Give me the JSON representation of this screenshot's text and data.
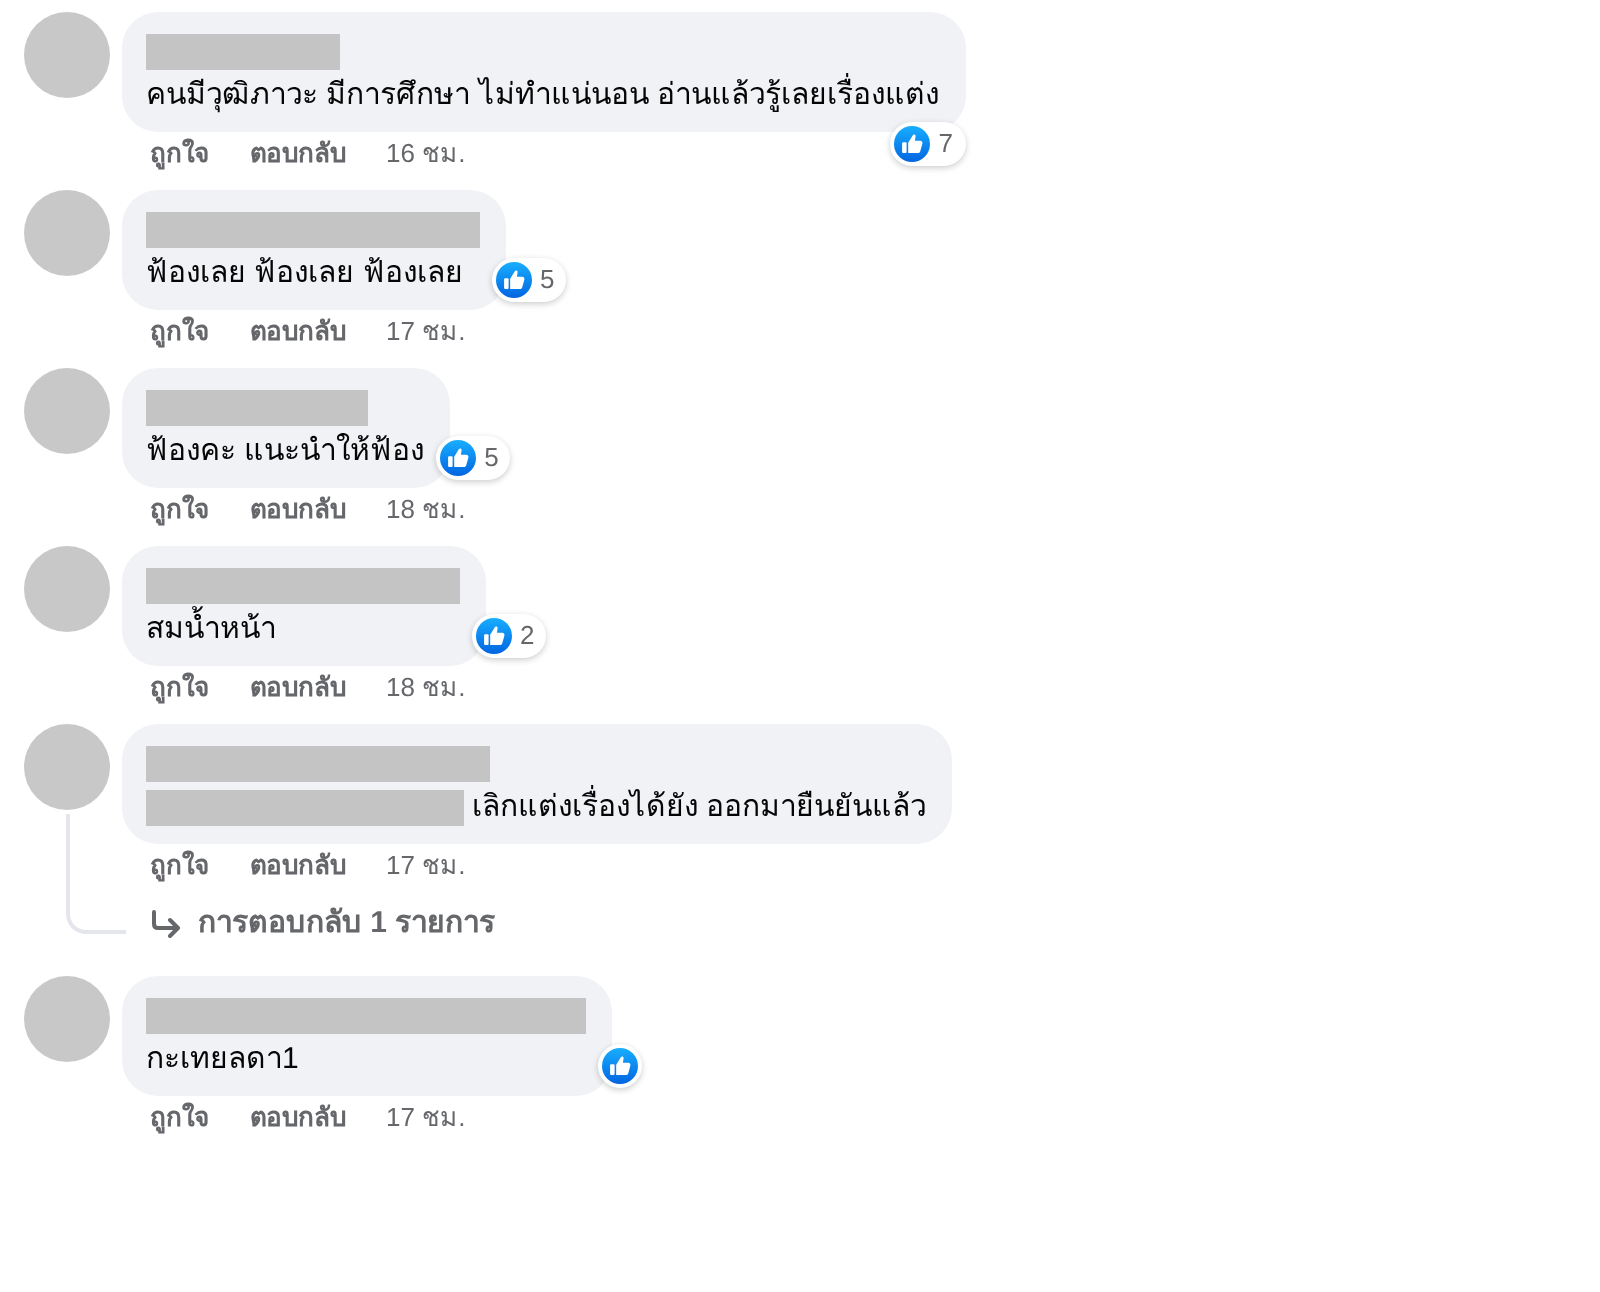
{
  "comments": [
    {
      "name_redacted": true,
      "text": "คนมีวุฒิภาวะ มีการศึกษา ไม่ทำแน่นอน อ่านแล้วรู้เลยเรื่องแต่ง",
      "reaction": {
        "kind": "like",
        "count": "7"
      },
      "actions": [
        "ถูกใจ",
        "ตอบกลับ"
      ],
      "time": "16 ชม."
    },
    {
      "name_redacted": true,
      "text": "ฟ้องเลย ฟ้องเลย ฟ้องเลย",
      "reaction": {
        "kind": "like",
        "count": "5"
      },
      "actions": [
        "ถูกใจ",
        "ตอบกลับ"
      ],
      "time": "17 ชม."
    },
    {
      "name_redacted": true,
      "text": "ฟ้องคะ แนะนำให้ฟ้อง",
      "reaction": {
        "kind": "like",
        "count": "5"
      },
      "actions": [
        "ถูกใจ",
        "ตอบกลับ"
      ],
      "time": "18 ชม."
    },
    {
      "name_redacted": true,
      "text": "สมน้ำหน้า",
      "reaction": {
        "kind": "like",
        "count": "2"
      },
      "actions": [
        "ถูกใจ",
        "ตอบกลับ"
      ],
      "time": "18 ชม."
    },
    {
      "name_redacted": true,
      "mention_redacted": true,
      "text": "เลิกแต่งเรื่องได้ยัง ออกมายืนยันแล้ว",
      "actions": [
        "ถูกใจ",
        "ตอบกลับ"
      ],
      "time": "17 ชม.",
      "replies_link": "การตอบกลับ 1 รายการ"
    },
    {
      "name_redacted": true,
      "text": "กะเทยลดา1",
      "reaction": {
        "kind": "like"
      },
      "actions": [
        "ถูกใจ",
        "ตอบกลับ"
      ],
      "time": "17 ชม."
    }
  ]
}
